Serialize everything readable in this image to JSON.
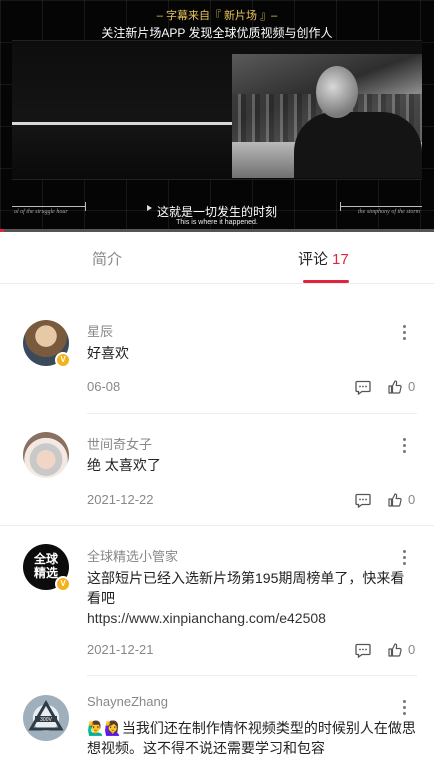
{
  "video": {
    "top_note": "– 字幕来自『 新片场 』–",
    "top_title": "关注新片场APP  发现全球优质视频与创作人",
    "subtitle_zh": "这就是一切发生的时刻",
    "subtitle_en": "This is where it happened.",
    "side_left": "ol of the struggle hour",
    "side_right": "the simphony of the storm",
    "progress": 0.01
  },
  "tabs": {
    "intro": "简介",
    "comments": "评论",
    "comments_count": "17"
  },
  "comments": [
    {
      "username": "星辰",
      "text": "好喜欢",
      "link": "",
      "date": "06-08",
      "likes": "0",
      "badge": "V"
    },
    {
      "username": "世间奇女子",
      "text": "绝 太喜欢了",
      "link": "",
      "date": "2021-12-22",
      "likes": "0",
      "badge": ""
    },
    {
      "username": "全球精选小管家",
      "text": "这部短片已经入选新片场第195期周榜单了，快来看看吧",
      "link": "https://www.xinpianchang.com/e42508",
      "date": "2021-12-21",
      "likes": "0",
      "badge": "V"
    },
    {
      "username": "ShayneZhang",
      "text": "🙋‍♂️🙋‍♀️当我们还在制作情怀视频类型的时候别人在做思想视频。这不得不说还需要学习和包容",
      "link": "",
      "date": "",
      "likes": "",
      "badge": ""
    }
  ],
  "avatar_text": {
    "c3_line1": "全球",
    "c3_line2": "精选",
    "c4": "300V"
  },
  "colors": {
    "accent": "#e0263b",
    "badge": "#f2b21d",
    "muted": "#888888"
  }
}
